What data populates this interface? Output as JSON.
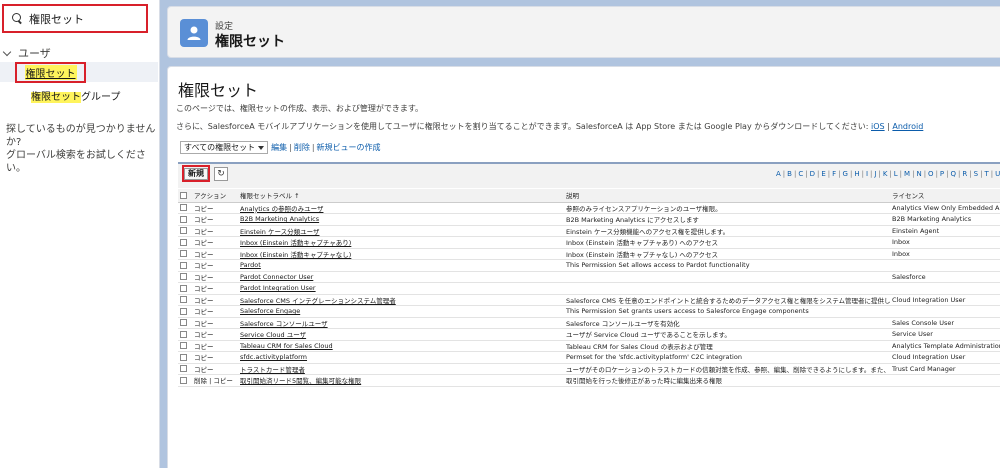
{
  "sidebar": {
    "search_value": "権限セット",
    "group_label": "ユーザ",
    "item1_label": "権限セット",
    "item2_hl": "権限セット",
    "item2_rest": "グループ",
    "not_found_line1": "探しているものが見つかりませんか?",
    "not_found_line2": "グローバル検索をお試しください。"
  },
  "header": {
    "subtitle": "設定",
    "title": "権限セット"
  },
  "page": {
    "title": "権限セット",
    "desc1": "このページでは、権限セットの作成、表示、および管理ができます。",
    "desc2": "さらに、SalesforceA モバイルアプリケーションを使用してユーザに権限セットを割り当てることができます。SalesforceA は App Store または Google Play からダウンロードしてください:",
    "ios_link": "iOS",
    "link_sep": " | ",
    "android_link": "Android"
  },
  "view": {
    "selected": "すべての権限セット",
    "edit": "編集",
    "sep": "|",
    "delete": "削除",
    "new_view": "新規ビューの作成"
  },
  "toolbar": {
    "new_label": "新規",
    "refresh_glyph": "↻"
  },
  "alphabet": [
    "A",
    "B",
    "C",
    "D",
    "E",
    "F",
    "G",
    "H",
    "I",
    "J",
    "K",
    "L",
    "M",
    "N",
    "O",
    "P",
    "Q",
    "R",
    "S",
    "T",
    "U"
  ],
  "table": {
    "headers": {
      "action": "アクション",
      "label": "権限セットラベル ↑",
      "description": "説明",
      "license": "ライセンス"
    },
    "rows": [
      {
        "action": "コピー",
        "label": "Analytics の参照のみユーザ",
        "description": "参照のみライセンスアプリケーションのユーザ権限。",
        "license": "Analytics View Only Embedded App"
      },
      {
        "action": "コピー",
        "label": "B2B Marketing Analytics",
        "description": "B2B Marketing Analytics にアクセスします",
        "license": "B2B Marketing Analytics"
      },
      {
        "action": "コピー",
        "label": "Einstein ケース分類ユーザ",
        "description": "Einstein ケース分類機能へのアクセス権を提供します。",
        "license": "Einstein Agent"
      },
      {
        "action": "コピー",
        "label": "Inbox (Einstein 活動キャプチャあり)",
        "description": "Inbox (Einstein 活動キャプチャあり) へのアクセス",
        "license": "Inbox"
      },
      {
        "action": "コピー",
        "label": "Inbox (Einstein 活動キャプチャなし)",
        "description": "Inbox (Einstein 活動キャプチャなし) へのアクセス",
        "license": "Inbox"
      },
      {
        "action": "コピー",
        "label": "Pardot",
        "description": "This Permission Set allows access to Pardot functionality",
        "license": ""
      },
      {
        "action": "コピー",
        "label": "Pardot Connector User",
        "description": "",
        "license": "Salesforce"
      },
      {
        "action": "コピー",
        "label": "Pardot Integration User",
        "description": "",
        "license": ""
      },
      {
        "action": "コピー",
        "label": "Salesforce CMS インテグレーションシステム管理者",
        "description": "Salesforce CMS を任意のエンドポイントと統合するためのデータアクセス権と権限をシステム管理者に提供します。",
        "license": "Cloud Integration User"
      },
      {
        "action": "コピー",
        "label": "Salesforce Engage",
        "description": "This Permission Set grants users access to Salesforce Engage components",
        "license": ""
      },
      {
        "action": "コピー",
        "label": "Salesforce コンソールユーザ",
        "description": "Salesforce コンソールユーザを有効化",
        "license": "Sales Console User"
      },
      {
        "action": "コピー",
        "label": "Service Cloud ユーザ",
        "description": "ユーザが Service Cloud ユーザであることを示します。",
        "license": "Service User"
      },
      {
        "action": "コピー",
        "label": "Tableau CRM for Sales Cloud",
        "description": "Tableau CRM for Sales Cloud の表示および管理",
        "license": "Analytics Template Administration"
      },
      {
        "action": "コピー",
        "label": "sfdc.activityplatform",
        "description": "Permset for the 'sfdc.activityplatform' C2C integration",
        "license": "Cloud Integration User"
      },
      {
        "action": "コピー",
        "label": "トラストカード管理者",
        "description": "ユーザがそのロケーションのトラストカードの信頼対策を作成、参照、編集、削除できるようにします。また、ユーザが...",
        "license": "Trust Card Manager"
      },
      {
        "action": "削除 | コピー",
        "label": "取引開始済リード5閲覧、編集可能な権限",
        "description": "取引開始を行った後修正があった時に編集出来る権限",
        "license": ""
      }
    ]
  },
  "colors": {
    "highlight_red": "#d8202a",
    "search_highlight": "#fff45c",
    "link_blue": "#0b5cab",
    "page_bg": "#b0c4df",
    "header_icon": "#5a8fd6"
  }
}
